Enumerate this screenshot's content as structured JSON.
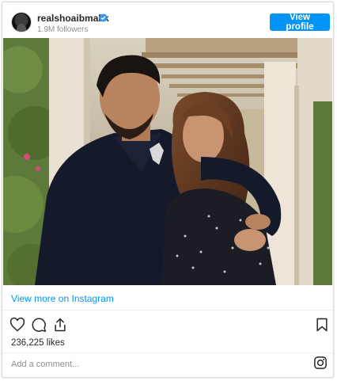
{
  "header": {
    "username": "realshoaibmalik",
    "verified": true,
    "followers": "1.9M followers",
    "view_profile_label": "View profile"
  },
  "post": {
    "image_alt": "Couple photo under pergola",
    "view_more_label": "View more on Instagram",
    "likes": "236,225 likes",
    "comment_placeholder": "Add a comment..."
  },
  "icons": {
    "like": "heart-icon",
    "comment": "comment-icon",
    "share": "share-icon",
    "save": "bookmark-icon",
    "brand": "instagram-icon",
    "verified": "verified-badge-icon"
  },
  "colors": {
    "accent": "#0095f6",
    "text": "#262626",
    "muted": "#8e8e8e"
  }
}
